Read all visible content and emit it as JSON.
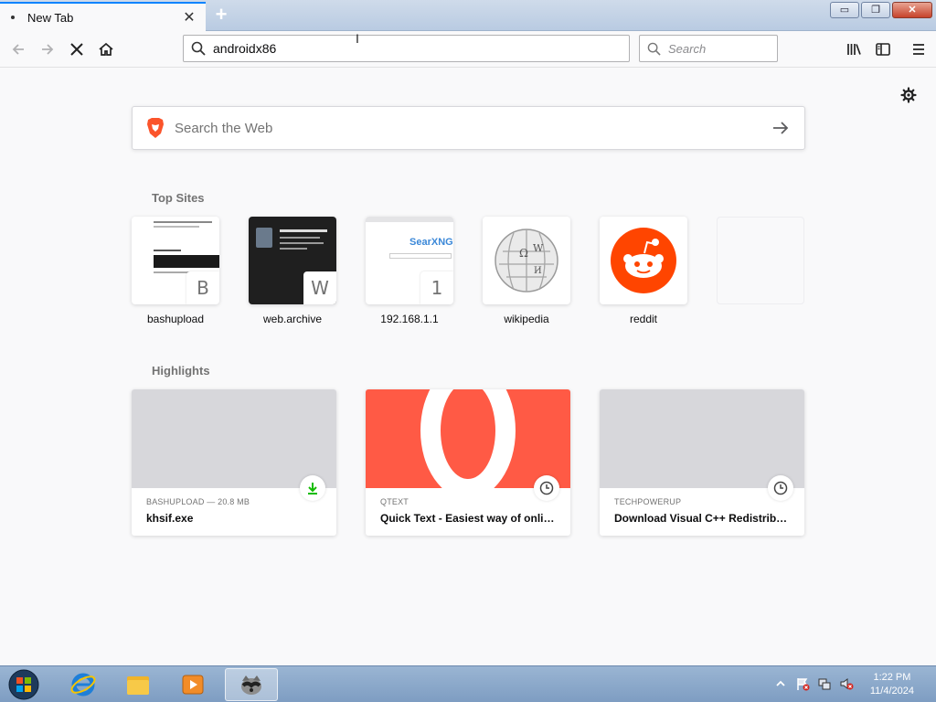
{
  "tab": {
    "title": "New Tab"
  },
  "window_buttons": {
    "minimize": "▭",
    "restore": "❐",
    "close": "✕"
  },
  "urlbar": {
    "value": "androidx86"
  },
  "searchbar": {
    "placeholder": "Search"
  },
  "websearch": {
    "placeholder": "Search the Web"
  },
  "top_sites": {
    "title": "Top Sites",
    "items": [
      {
        "label": "bashupload",
        "letter": "B"
      },
      {
        "label": "web.archive",
        "letter": "W"
      },
      {
        "label": "192.168.1.1",
        "letter": "1",
        "thumb_text": "SearXNG"
      },
      {
        "label": "wikipedia"
      },
      {
        "label": "reddit"
      }
    ]
  },
  "highlights": {
    "title": "Highlights",
    "items": [
      {
        "context": "BASHUPLOAD — 20.8 MB",
        "title": "khsif.exe",
        "icon": "download-icon"
      },
      {
        "context": "QTEXT",
        "title": "Quick Text - Easiest way of onlin...",
        "icon": "clock-icon"
      },
      {
        "context": "TECHPOWERUP",
        "title": "Download Visual C++ Redistribu...",
        "icon": "clock-icon"
      }
    ]
  },
  "clock": {
    "time": "1:22 PM",
    "date": "11/4/2024"
  },
  "colors": {
    "accent": "#0a84ff",
    "reddit": "#ff4500",
    "qtext": "#ff5a45",
    "download": "#12bc00"
  }
}
